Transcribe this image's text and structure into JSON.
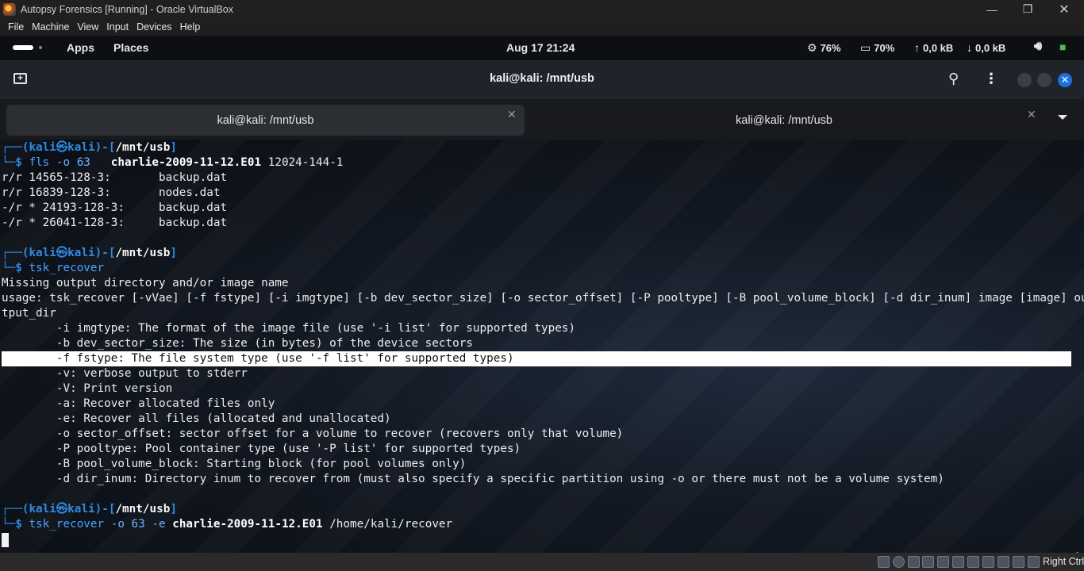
{
  "window": {
    "title": "Autopsy Forensics [Running] - Oracle VirtualBox"
  },
  "menubar": [
    "File",
    "Machine",
    "View",
    "Input",
    "Devices",
    "Help"
  ],
  "topbar": {
    "apps": "Apps",
    "places": "Places",
    "clock": "Aug 17  21:24",
    "cpu": "76%",
    "mem": "70%",
    "upload": "0,0 kB",
    "download": "0,0 kB"
  },
  "terminal": {
    "title": "kali@kali: /mnt/usb",
    "tabs": [
      {
        "label": "kali@kali: /mnt/usb",
        "active": true
      },
      {
        "label": "kali@kali: /mnt/usb",
        "active": false
      }
    ]
  },
  "prompt": {
    "user": "kali",
    "host": "kali",
    "cwd": "/mnt/usb"
  },
  "session": {
    "cmd1": {
      "name": "fls",
      "options": "-o 63",
      "image": "charlie-2009-11-12.E01",
      "arg": "12024-144-1"
    },
    "fls_output": [
      "r/r 14565-128-3:       backup.dat",
      "r/r 16839-128-3:       nodes.dat",
      "-/r * 24193-128-3:     backup.dat",
      "-/r * 26041-128-3:     backup.dat"
    ],
    "cmd2": {
      "name": "tsk_recover"
    },
    "usage_output": [
      "Missing output directory and/or image name",
      "usage: tsk_recover [-vVae] [-f fstype] [-i imgtype] [-b dev_sector_size] [-o sector_offset] [-P pooltype] [-B pool_volume_block] [-d dir_inum] image [image] ou",
      "tput_dir",
      "        -i imgtype: The format of the image file (use '-i list' for supported types)",
      "        -b dev_sector_size: The size (in bytes) of the device sectors",
      "        -f fstype: The file system type (use '-f list' for supported types)",
      "        -v: verbose output to stderr",
      "        -V: Print version",
      "        -a: Recover allocated files only",
      "        -e: Recover all files (allocated and unallocated)",
      "        -o sector_offset: sector offset for a volume to recover (recovers only that volume)",
      "        -P pooltype: Pool container type (use '-P list' for supported types)",
      "        -B pool_volume_block: Starting block (for pool volumes only)",
      "        -d dir_inum: Directory inum to recover from (must also specify a specific partition using -o or there must not be a volume system)"
    ],
    "highlighted_line_index": 5,
    "cmd3": {
      "name": "tsk_recover",
      "options": "-o 63 -e",
      "image": "charlie-2009-11-12.E01",
      "dest": "/home/kali/recover"
    }
  },
  "statusbar": {
    "host_key": "Right Ctrl"
  }
}
